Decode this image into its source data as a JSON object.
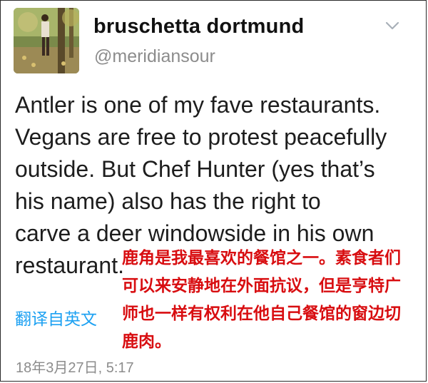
{
  "tweet": {
    "display_name": "bruschetta dortmund",
    "handle": "@meridiansour",
    "text_lines": [
      "Antler is one of my fave restaurants.",
      "Vegans are free to protest peacefully",
      "outside. But Chef Hunter (yes that’s",
      "his name) also has the right to",
      "carve a deer windowside in his own",
      "restaurant."
    ],
    "translation_overlay_lines": [
      "鹿角是我最喜欢的餐馆之一。素食者们",
      "可以来安静地在外面抗议，但是亨特广",
      "师也一样有权利在他自己餐馆的窗边切",
      "鹿肉。"
    ],
    "translate_link": "翻译自英文",
    "timestamp": "18年3月27日, 5:17"
  },
  "icons": {
    "avatar": "avatar-photo",
    "menu": "chevron-down-icon"
  },
  "colors": {
    "link_blue": "#1da1f2",
    "overlay_red": "#d80d10",
    "muted_gray": "#8c8c8c"
  }
}
